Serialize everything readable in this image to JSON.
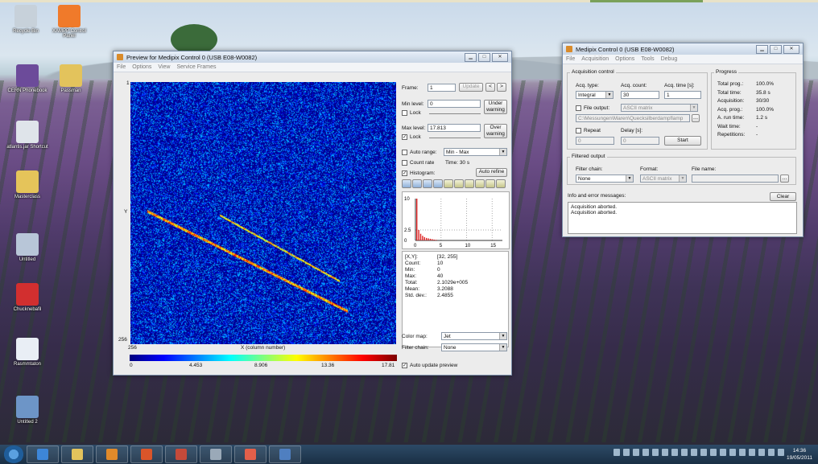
{
  "desktop_icons": [
    {
      "label": "Recycle Bin",
      "color": "#c7d1da"
    },
    {
      "label": "XAMPP Control Panel",
      "color": "#f07a2a"
    },
    {
      "label": "CERN Phonebook",
      "color": "#6c4b9a"
    },
    {
      "label": "Passman",
      "color": "#e3c35c"
    },
    {
      "label": "atlantis.jar Shortcut",
      "color": "#dfe4ea"
    },
    {
      "label": "Masterclass",
      "color": "#e5c45a"
    },
    {
      "label": "Untitled",
      "color": "#b8c6d8"
    },
    {
      "label": "Chucknebafil",
      "color": "#d22f2f"
    },
    {
      "label": "Rasmmtaton",
      "color": "#e9eef5"
    },
    {
      "label": "Untitled 2",
      "color": "#6d95c7"
    }
  ],
  "preview": {
    "title": "Preview for Medipix Control 0 (USB E08-W0082)",
    "menu": [
      "File",
      "Options",
      "View",
      "Service Frames"
    ],
    "axis": {
      "y_top": "1",
      "y_label": "Y",
      "y_bottom": "256",
      "x_left": "256",
      "x_label": "X (column number)"
    },
    "colorbar_ticks": [
      "0",
      "4.453",
      "8.906",
      "13.36",
      "17.81"
    ],
    "frame_label": "Frame:",
    "frame_value": "1",
    "update_label": "Update",
    "prev": "<",
    "next": ">",
    "min_level_label": "Min level:",
    "min_level_value": "0",
    "lock_label": "Lock",
    "under_warning": "Under warning",
    "max_level_label": "Max level:",
    "max_level_value": "17.813",
    "over_warning": "Over warning",
    "auto_range_label": "Auto range:",
    "auto_range_value": "Min - Max",
    "count_rate_label": "Count rate",
    "time_label": "Time: 30 s",
    "histogram_label": "Histogram:",
    "auto_refine": "Auto refine",
    "histogram": {
      "y_ticks": [
        "10",
        "2.5",
        "0"
      ],
      "x_ticks": [
        "0",
        "5",
        "10",
        "15"
      ],
      "bars": [
        10,
        2.5,
        1.6,
        1.1,
        0.8,
        0.6,
        0.5,
        0.4,
        0.3,
        0.2,
        0.15
      ]
    },
    "stats": [
      {
        "k": "[X,Y]:",
        "v": "[32, 255]"
      },
      {
        "k": "Count:",
        "v": "10"
      },
      {
        "k": "Min:",
        "v": "0"
      },
      {
        "k": "Max:",
        "v": "40"
      },
      {
        "k": "Total:",
        "v": "2.1029e+005"
      },
      {
        "k": "Mean:",
        "v": "3.2088"
      },
      {
        "k": "Std. dev.:",
        "v": "2.4855"
      }
    ],
    "color_map_label": "Color map:",
    "color_map_value": "Jet",
    "filter_chain_label": "Filter chain:",
    "filter_chain_value": "None",
    "auto_update_label": "Auto update preview"
  },
  "control": {
    "title": "Medipix Control 0 (USB E08-W0082)",
    "menu": [
      "File",
      "Acquisition",
      "Options",
      "Tools",
      "Debug"
    ],
    "acq_group": "Acquisition control",
    "acq_type_label": "Acq. type:",
    "acq_type_value": "Integral",
    "acq_count_label": "Acq. count:",
    "acq_count_value": "30",
    "acq_time_label": "Acq. time [s]:",
    "acq_time_value": "1",
    "file_output_label": "File output:",
    "file_output_value": "ASCII matrix",
    "file_path": "C:\\Messungen\\Maren\\Quecksilberdampflamp",
    "repeat_label": "Repeat",
    "repeat_value": "0",
    "delay_label": "Delay [s]:",
    "delay_value": "0",
    "start_label": "Start",
    "progress_group": "Progress",
    "progress": [
      {
        "k": "Total prog.:",
        "v": "100.0%"
      },
      {
        "k": "Total time:",
        "v": "35.8 s"
      },
      {
        "k": "Acquisition:",
        "v": "30/30"
      },
      {
        "k": "Acq. prog.:",
        "v": "100.0%"
      },
      {
        "k": "A. run time:",
        "v": "1.2 s"
      },
      {
        "k": "Wait time:",
        "v": "-"
      },
      {
        "k": "Repetitions:",
        "v": "-"
      }
    ],
    "filtered_group": "Filtered output",
    "filter_chain_label": "Filter chain:",
    "filter_chain_value": "None",
    "format_label": "Format:",
    "format_value": "ASCII matrix",
    "file_name_label": "File name:",
    "file_name_value": "",
    "info_label": "Info and error messages:",
    "clear_label": "Clear",
    "messages": [
      "Acquisition aborted.",
      "Acquisition aborted."
    ]
  },
  "taskbar": {
    "time": "14:36",
    "date": "19/05/2011",
    "buttons": [
      {
        "name": "ie",
        "color": "#3d86d8"
      },
      {
        "name": "explorer",
        "color": "#e3c35c"
      },
      {
        "name": "media",
        "color": "#e08a2a"
      },
      {
        "name": "app-orange",
        "color": "#d9552a"
      },
      {
        "name": "app-target",
        "color": "#c44a3a"
      },
      {
        "name": "app-disc",
        "color": "#9aa9b8"
      },
      {
        "name": "app-paint",
        "color": "#e25f4a"
      },
      {
        "name": "app-window",
        "color": "#4f7fc0"
      }
    ]
  }
}
